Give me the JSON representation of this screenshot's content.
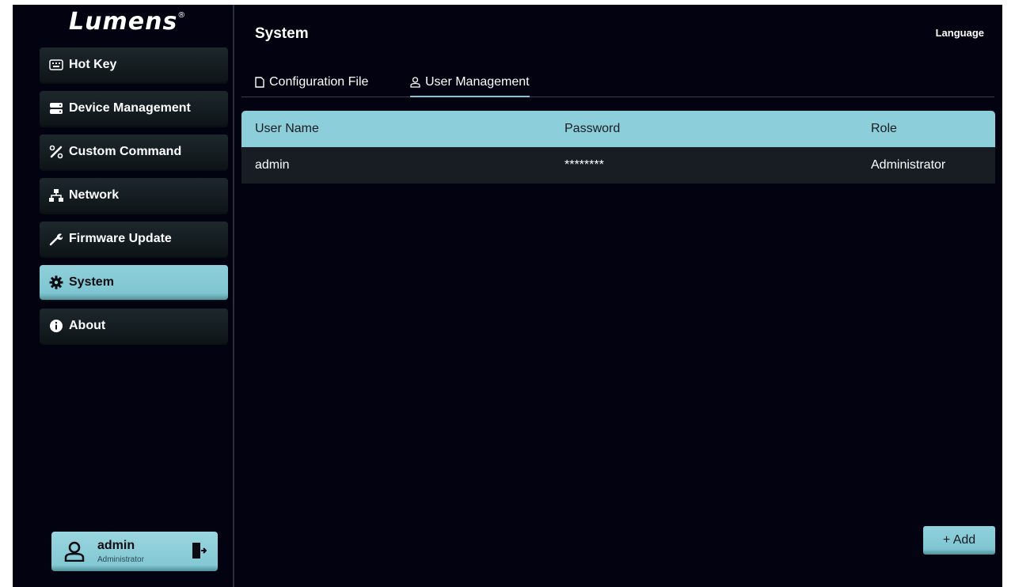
{
  "brand": {
    "logo_text": "Lumens",
    "logo_mark": "®"
  },
  "sidebar": {
    "items": [
      {
        "label": "Hot Key",
        "icon": "keyboard-icon"
      },
      {
        "label": "Device Management",
        "icon": "server-icon"
      },
      {
        "label": "Custom Command",
        "icon": "tools-icon"
      },
      {
        "label": "Network",
        "icon": "network-icon"
      },
      {
        "label": "Firmware Update",
        "icon": "wrench-icon"
      },
      {
        "label": "System",
        "icon": "gear-icon",
        "active": true
      },
      {
        "label": "About",
        "icon": "info-icon"
      }
    ],
    "user": {
      "name": "admin",
      "role": "Administrator"
    }
  },
  "header": {
    "title": "System",
    "language_label": "Language"
  },
  "tabs": [
    {
      "label": "Configuration File",
      "icon": "file-icon"
    },
    {
      "label": "User Management",
      "icon": "user-icon",
      "active": true
    }
  ],
  "table": {
    "columns": [
      "User Name",
      "Password",
      "Role"
    ],
    "rows": [
      [
        "admin",
        "********",
        "Administrator"
      ]
    ]
  },
  "actions": {
    "add_label": "+ Add"
  },
  "colors": {
    "accent": "#8ccfda",
    "background": "#020210",
    "row": "#171d23"
  }
}
